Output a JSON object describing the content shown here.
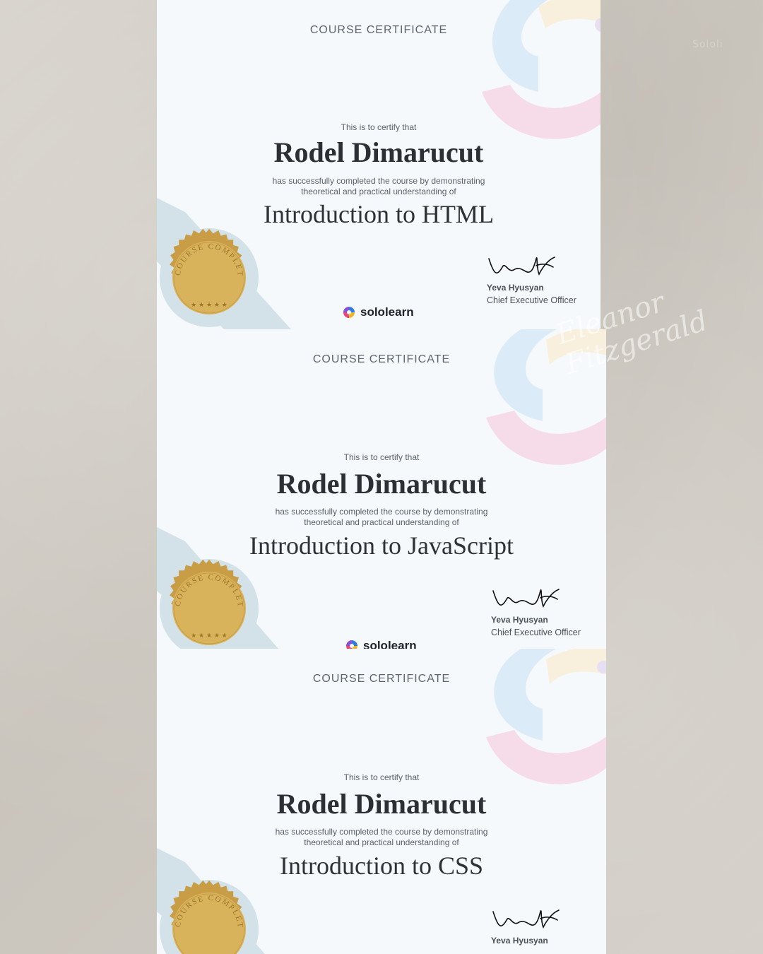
{
  "corner_label": "Sololi",
  "watermark": {
    "line1": "Eleanor",
    "line2": "Fitzgerald"
  },
  "certificates": [
    {
      "heading": "COURSE CERTIFICATE",
      "certify_text": "This is to certify that",
      "recipient": "Rodel Dimarucut",
      "description_line1": "has successfully completed the course by demonstrating",
      "description_line2": "theoretical and practical understanding of",
      "course": "Introduction to HTML",
      "seal_text": "COURSE COMPLETED",
      "brand": "sololearn",
      "signer_name": "Yeva Hyusyan",
      "signer_title": "Chief Executive Officer"
    },
    {
      "heading": "COURSE CERTIFICATE",
      "certify_text": "This is to certify that",
      "recipient": "Rodel Dimarucut",
      "description_line1": "has successfully completed the course by demonstrating",
      "description_line2": "theoretical and practical understanding of",
      "course": "Introduction to JavaScript",
      "seal_text": "COURSE COMPLETED",
      "brand": "sololearn",
      "signer_name": "Yeva Hyusyan",
      "signer_title": "Chief Executive Officer"
    },
    {
      "heading": "COURSE CERTIFICATE",
      "certify_text": "This is to certify that",
      "recipient": "Rodel Dimarucut",
      "description_line1": "has successfully completed the course by demonstrating",
      "description_line2": "theoretical and practical understanding of",
      "course": "Introduction to CSS",
      "seal_text": "COURSE COMPLETED",
      "signer_name": "Yeva Hyusyan"
    }
  ],
  "colors": {
    "seal_gold": "#d9b35c",
    "seal_ring": "#c89d45",
    "swirl_blue": "#dcebf8",
    "swirl_pink": "#f6dbe8",
    "swirl_yellow": "#f8efdc",
    "ribbon": "#d3e1e8"
  }
}
